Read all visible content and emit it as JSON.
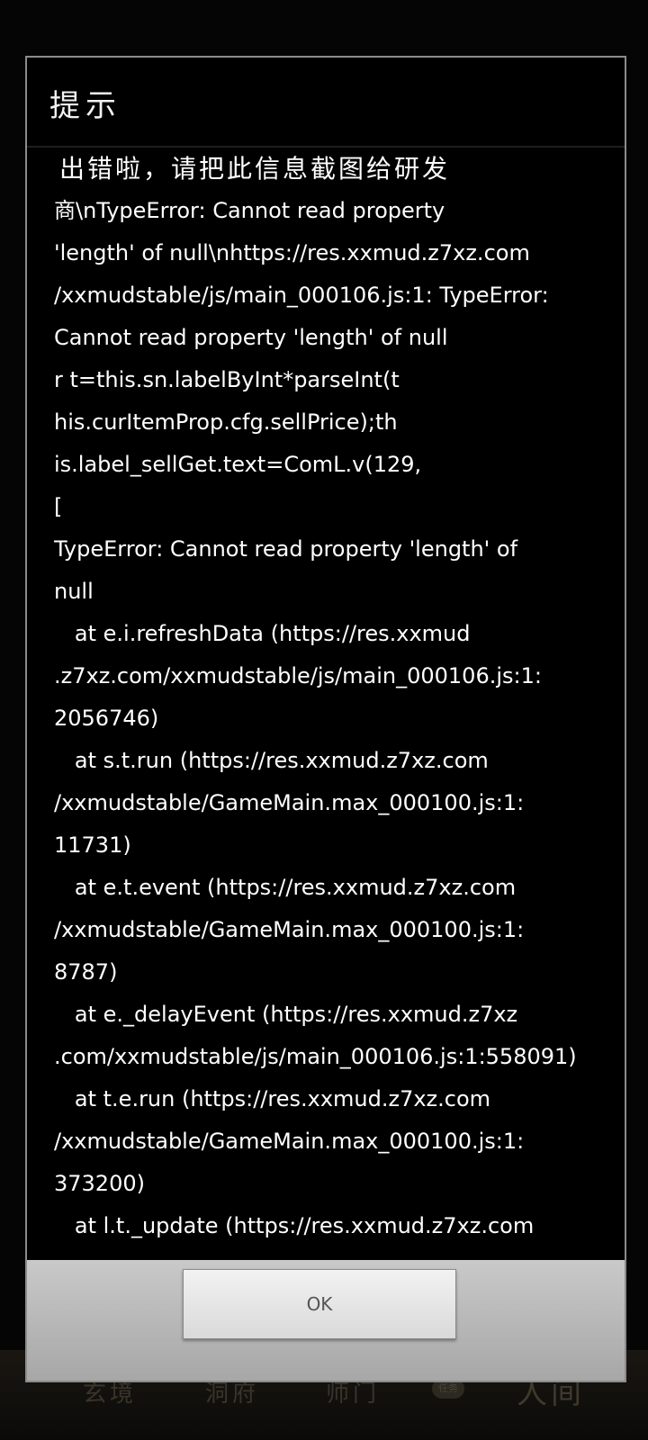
{
  "nav": {
    "items": [
      "玄境",
      "洞府",
      "师门",
      "人间"
    ],
    "badge": "任务"
  },
  "dialog": {
    "title": "提示",
    "message_lines": [
      "出错啦，请把此信息截图给研发",
      "商\\nTypeError: Cannot read property",
      "'length' of null\\nhttps://res.xxmud.z7xz.com",
      "/xxmudstable/js/main_000106.js:1: TypeError:",
      "Cannot read property 'length' of null",
      "r t=this.sn.labelByInt*parseInt(t",
      "his.curItemProp.cfg.sellPrice);th",
      "is.label_sellGet.text=ComL.v(129,",
      "[",
      "TypeError: Cannot read property 'length' of",
      "null",
      "   at e.i.refreshData (https://res.xxmud",
      ".z7xz.com/xxmudstable/js/main_000106.js:1:",
      "2056746)",
      "   at s.t.run (https://res.xxmud.z7xz.com",
      "/xxmudstable/GameMain.max_000100.js:1:",
      "11731)",
      "   at e.t.event (https://res.xxmud.z7xz.com",
      "/xxmudstable/GameMain.max_000100.js:1:",
      "8787)",
      "   at e._delayEvent (https://res.xxmud.z7xz",
      ".com/xxmudstable/js/main_000106.js:1:558091)",
      "   at t.e.run (https://res.xxmud.z7xz.com",
      "/xxmudstable/GameMain.max_000100.js:1:",
      "373200)",
      "   at l.t._update (https://res.xxmud.z7xz.com"
    ],
    "ok_label": "OK"
  }
}
